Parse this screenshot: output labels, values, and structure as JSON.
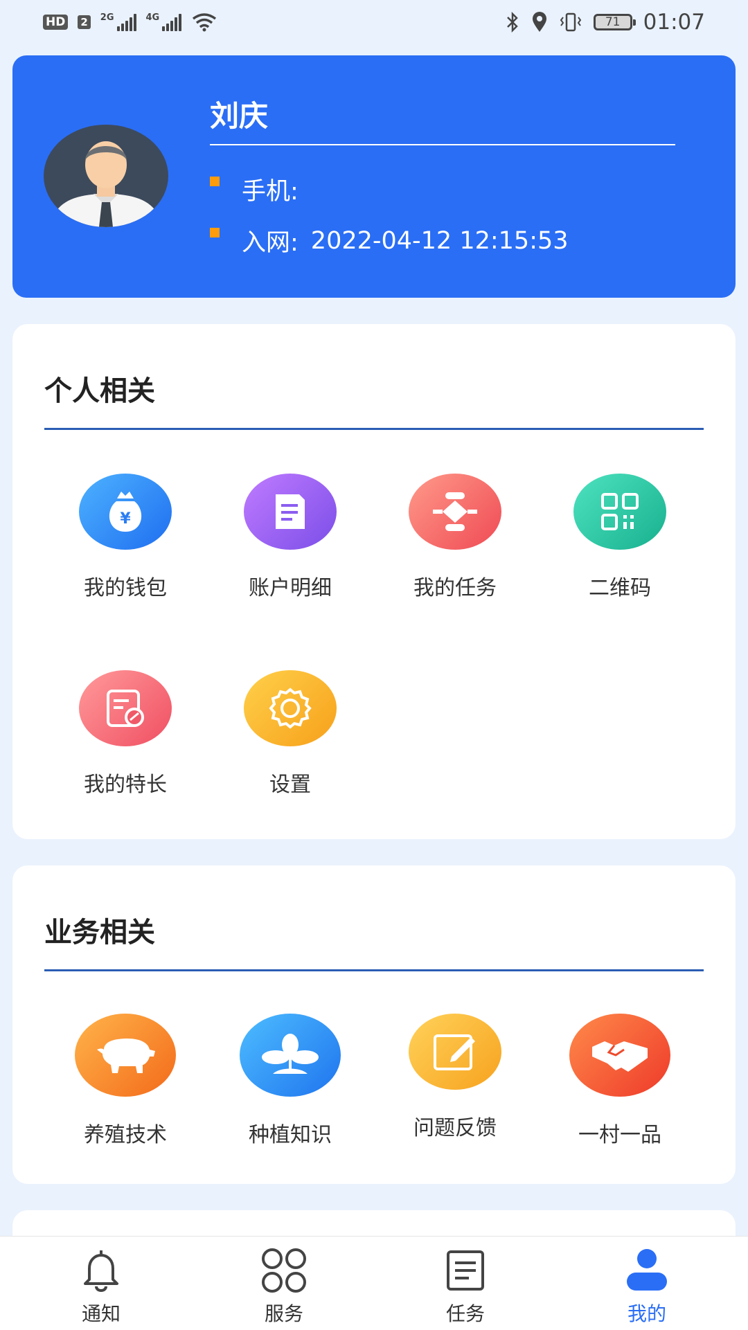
{
  "status_bar": {
    "hd": "HD",
    "sim": "2",
    "net1": "2G",
    "net2": "4G",
    "battery": "71",
    "time": "01:07"
  },
  "profile": {
    "name": "刘庆",
    "phone_label": "手机:",
    "phone_value": "",
    "join_label": "入网:",
    "join_value": "2022-04-12 12:15:53"
  },
  "personal": {
    "title": "个人相关",
    "items": [
      {
        "label": "我的钱包",
        "icon": "wallet-icon"
      },
      {
        "label": "账户明细",
        "icon": "document-icon"
      },
      {
        "label": "我的任务",
        "icon": "task-flow-icon"
      },
      {
        "label": "二维码",
        "icon": "qrcode-icon"
      },
      {
        "label": "我的特长",
        "icon": "skill-icon"
      },
      {
        "label": "设置",
        "icon": "gear-icon"
      }
    ]
  },
  "business": {
    "title": "业务相关",
    "items": [
      {
        "label": "养殖技术",
        "icon": "pig-icon"
      },
      {
        "label": "种植知识",
        "icon": "sprout-icon"
      },
      {
        "label": "问题反馈",
        "icon": "edit-icon"
      },
      {
        "label": "一村一品",
        "icon": "handshake-icon"
      }
    ]
  },
  "nav": {
    "items": [
      {
        "label": "通知",
        "icon": "bell-icon"
      },
      {
        "label": "服务",
        "icon": "grid-icon"
      },
      {
        "label": "任务",
        "icon": "list-icon"
      },
      {
        "label": "我的",
        "icon": "user-icon",
        "active": true
      }
    ]
  },
  "colors": {
    "accent": "#2a6ef5",
    "background": "#eaf2fd",
    "bullet": "#ff9c0c"
  }
}
